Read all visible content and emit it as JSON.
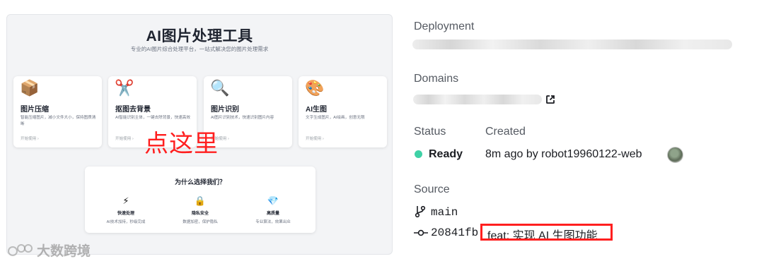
{
  "preview": {
    "title": "AI图片处理工具",
    "subtitle": "专业的AI图片综合处理平台，一站式解决您的图片处理需求",
    "cards": [
      {
        "icon": "package-icon",
        "glyph": "📦",
        "title": "图片压缩",
        "desc": "智能压缩图片，减小文件大小，保持图质清晰",
        "link": "开始使用 ›"
      },
      {
        "icon": "scissors-icon",
        "glyph": "✂️",
        "title": "抠图去背景",
        "desc": "AI智能识别主体，一键去除背景，快速高效",
        "link": "开始使用 ›"
      },
      {
        "icon": "magnifier-icon",
        "glyph": "🔍",
        "title": "图片识别",
        "desc": "AI图片识别技术，快速识别图片内容",
        "link": "开始使用 ›"
      },
      {
        "icon": "palette-icon",
        "glyph": "🎨",
        "title": "AI生图",
        "desc": "文字生成图片，AI绘画，创意无限",
        "link": "开始使用 ›"
      }
    ],
    "annotation": "点这里",
    "why": {
      "title": "为什么选择我们？",
      "features": [
        {
          "icon": "lightning-icon",
          "glyph": "⚡",
          "title": "快速处理",
          "desc": "AI技术加持，秒级完成"
        },
        {
          "icon": "lock-icon",
          "glyph": "🔒",
          "title": "隐私安全",
          "desc": "数据加密，保护隐私"
        },
        {
          "icon": "diamond-icon",
          "glyph": "💎",
          "title": "高质量",
          "desc": "专业算法，效果出众"
        }
      ]
    },
    "watermark": "大数跨境"
  },
  "details": {
    "deployment_label": "Deployment",
    "domains_label": "Domains",
    "status_label": "Status",
    "created_label": "Created",
    "status_value": "Ready",
    "status_color": "#3fd1a6",
    "created_value": "8m ago by robot19960122-web",
    "source_label": "Source",
    "branch": "main",
    "commit_hash": "20841fb",
    "commit_message": "feat: 实现 AI 生图功能",
    "highlight_color": "#ff1f1f"
  }
}
